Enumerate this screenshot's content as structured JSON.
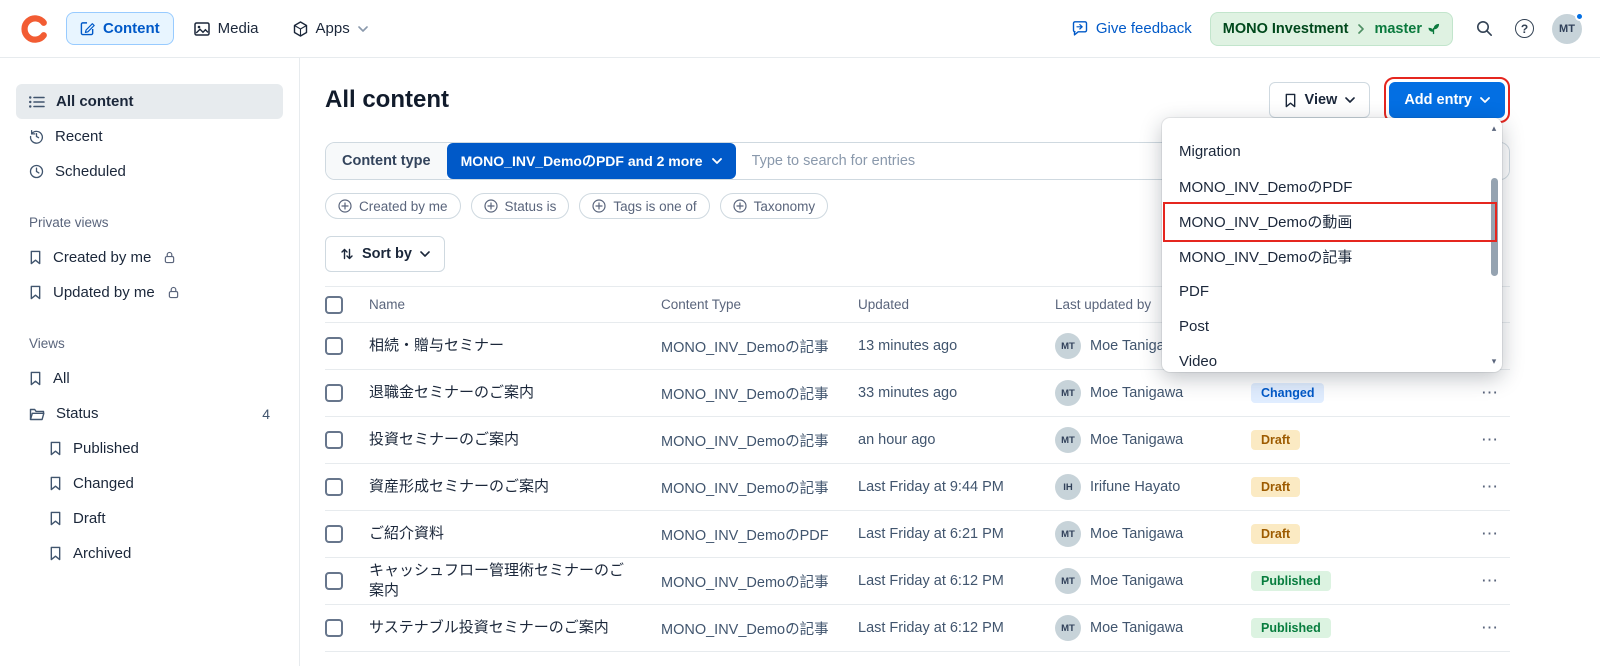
{
  "topbar": {
    "tabs": [
      {
        "label": "Content"
      },
      {
        "label": "Media"
      },
      {
        "label": "Apps"
      }
    ],
    "feedback_label": "Give feedback",
    "space_name": "MONO Investment",
    "environment": "master",
    "avatar_initials": "MT"
  },
  "sidebar": {
    "items": [
      {
        "label": "All content"
      },
      {
        "label": "Recent"
      },
      {
        "label": "Scheduled"
      }
    ],
    "private_title": "Private views",
    "private_items": [
      {
        "label": "Created by me"
      },
      {
        "label": "Updated by me"
      }
    ],
    "views_title": "Views",
    "views_items": [
      {
        "label": "All"
      },
      {
        "label": "Status",
        "count": "4"
      }
    ],
    "status_children": [
      {
        "label": "Published"
      },
      {
        "label": "Changed"
      },
      {
        "label": "Draft"
      },
      {
        "label": "Archived"
      }
    ]
  },
  "main": {
    "title": "All content",
    "view_label": "View",
    "add_entry_label": "Add entry",
    "search": {
      "label": "Content type",
      "selected": "MONO_INV_DemoのPDF and 2 more",
      "placeholder": "Type to search for entries"
    },
    "filters": [
      {
        "label": "Created by me"
      },
      {
        "label": "Status is"
      },
      {
        "label": "Tags is one of"
      },
      {
        "label": "Taxonomy"
      }
    ],
    "sort_label": "Sort by"
  },
  "table": {
    "headers": {
      "name": "Name",
      "content_type": "Content Type",
      "updated": "Updated",
      "last_updated_by": "Last updated by"
    },
    "rows": [
      {
        "name": "相続・贈与セミナー",
        "content_type": "MONO_INV_Demoの記事",
        "updated": "13 minutes ago",
        "by": "Moe Tanigawa",
        "initials": "MT"
      },
      {
        "name": "退職金セミナーのご案内",
        "content_type": "MONO_INV_Demoの記事",
        "updated": "33 minutes ago",
        "by": "Moe Tanigawa",
        "initials": "MT",
        "status": "Changed"
      },
      {
        "name": "投資セミナーのご案内",
        "content_type": "MONO_INV_Demoの記事",
        "updated": "an hour ago",
        "by": "Moe Tanigawa",
        "initials": "MT",
        "status": "Draft"
      },
      {
        "name": "資産形成セミナーのご案内",
        "content_type": "MONO_INV_Demoの記事",
        "updated": "Last Friday at 9:44 PM",
        "by": "Irifune Hayato",
        "initials": "IH",
        "status": "Draft"
      },
      {
        "name": "ご紹介資料",
        "content_type": "MONO_INV_DemoのPDF",
        "updated": "Last Friday at 6:21 PM",
        "by": "Moe Tanigawa",
        "initials": "MT",
        "status": "Draft"
      },
      {
        "name": "キャッシュフロー管理術セミナーのご案内",
        "content_type": "MONO_INV_Demoの記事",
        "updated": "Last Friday at 6:12 PM",
        "by": "Moe Tanigawa",
        "initials": "MT",
        "status": "Published"
      },
      {
        "name": "サステナブル投資セミナーのご案内",
        "content_type": "MONO_INV_Demoの記事",
        "updated": "Last Friday at 6:12 PM",
        "by": "Moe Tanigawa",
        "initials": "MT",
        "status": "Published"
      }
    ]
  },
  "add_entry_menu": {
    "items": [
      {
        "label": "Migration"
      },
      {
        "label": "MONO_INV_DemoのPDF"
      },
      {
        "label": "MONO_INV_Demoの動画",
        "highlighted": true
      },
      {
        "label": "MONO_INV_Demoの記事"
      },
      {
        "label": "PDF"
      },
      {
        "label": "Post"
      },
      {
        "label": "Video"
      }
    ]
  },
  "icons": {
    "ellipsis": "⋯",
    "scroll_up": "▴",
    "scroll_down": "▾",
    "help": "?"
  },
  "colors": {
    "accent_blue": "#0059C8",
    "primary_button_blue": "#036FE3",
    "annotation_red": "#E5261F",
    "status_changed_text": "#0059C8",
    "status_draft_text": "#9D5B00",
    "status_published_text": "#077D3E",
    "environment_green": "#0B7A3E"
  }
}
